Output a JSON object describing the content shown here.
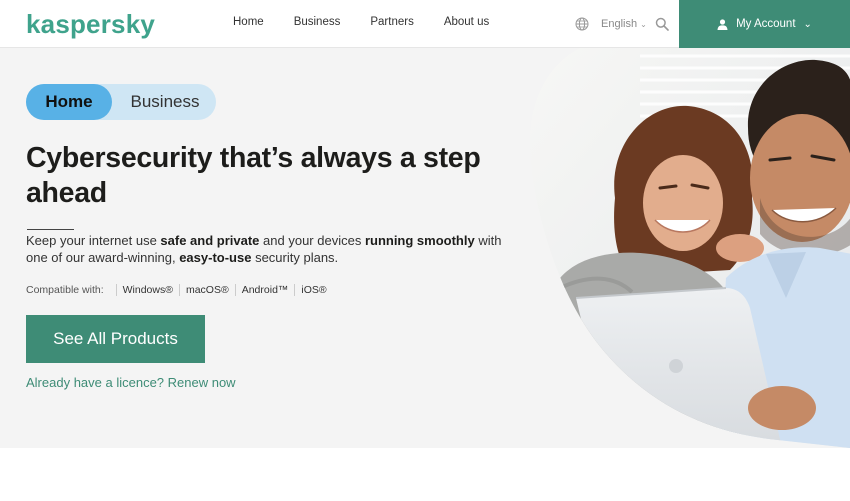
{
  "header": {
    "logo": "kaspersky",
    "nav": [
      "Home",
      "Business",
      "Partners",
      "About us"
    ],
    "language": "English",
    "account": "My Account"
  },
  "hero": {
    "toggle": {
      "home": "Home",
      "business": "Business"
    },
    "headline": "Cybersecurity that’s always a step ahead",
    "description": {
      "p1": "Keep your internet use ",
      "b1": "safe and private",
      "p2": " and your devices ",
      "b2": "running smoothly",
      "p3": " with one of our award-winning, ",
      "b3": "easy-to-use",
      "p4": " security plans."
    },
    "compatible_label": "Compatible with:",
    "platforms": [
      "Windows®",
      "macOS®",
      "Android™",
      "iOS®"
    ],
    "cta": "See All Products",
    "renew_link": "Already have a licence? Renew now"
  },
  "colors": {
    "brand_green": "#3e8c76",
    "logo_green": "#3fa38c",
    "toggle_active": "#58b1e6",
    "toggle_bg": "#cfe6f4"
  },
  "icons": [
    "globe-icon",
    "chevron-down-icon",
    "search-icon",
    "user-icon"
  ]
}
